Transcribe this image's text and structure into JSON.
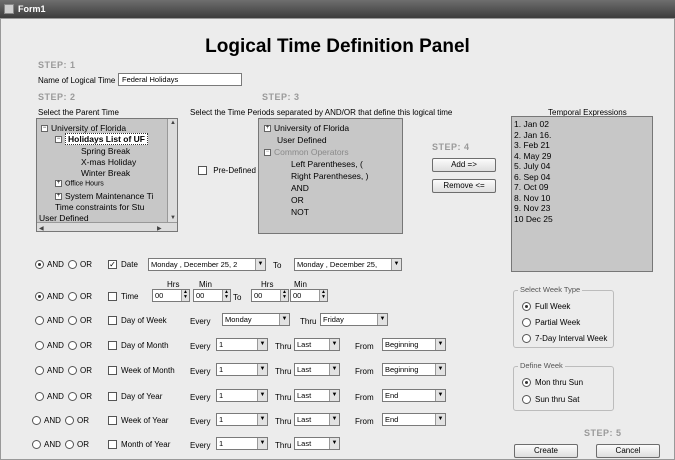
{
  "window": {
    "title": "Form1"
  },
  "page_title": "Logical Time Definition Panel",
  "steps": {
    "s1": "STEP: 1",
    "s2": "STEP: 2",
    "s3": "STEP: 3",
    "s4": "STEP: 4",
    "s5": "STEP: 5"
  },
  "name": {
    "label": "Name of Logical Time",
    "value": "Federal Holidays"
  },
  "parent": {
    "label": "Select the Parent Time",
    "items": {
      "uf": "University of Florida",
      "holidays": "Holidays List of UF",
      "spring": "Spring Break",
      "xmas": "X-mas Holiday",
      "winter": "Winter Break",
      "office": "Office Hours",
      "sysmaint": "System Maintenance Ti",
      "constraints": "Time constraints for Stu",
      "userdef": "User Defined"
    }
  },
  "periods": {
    "label": "Select the  Time Periods separated by AND/OR that define this logical time",
    "predefined_label": "Pre-Defined",
    "items": {
      "uf": "University of Florida",
      "userdef": "User Defined",
      "common": "Common Operators",
      "lparen": "Left Parentheses, (",
      "rparen": "Right Parentheses, )",
      "and": "AND",
      "or": "OR",
      "not": "NOT"
    }
  },
  "buttons": {
    "add": "Add =>",
    "remove": "Remove <=",
    "create": "Create",
    "cancel": "Cancel"
  },
  "temporal": {
    "label": "Temporal Expressions",
    "items": [
      "1. Jan 02",
      "2. Jan 16.",
      "3. Feb 21",
      "4. May 29",
      "5. July 04",
      "6. Sep 04",
      "7. Oct 09",
      "8. Nov 10",
      "9. Nov 23",
      "10 Dec 25"
    ]
  },
  "ops": {
    "and": "AND",
    "or": "OR"
  },
  "words": {
    "to": "To",
    "every": "Every",
    "thru": "Thru",
    "from": "From",
    "hrs": "Hrs",
    "min": "Min"
  },
  "rows": {
    "date": {
      "label": "Date",
      "from": "Monday    , December 25, 2",
      "to": "Monday    , December 25,"
    },
    "time": {
      "label": "Time",
      "h1": "00",
      "m1": "00",
      "h2": "00",
      "m2": "00"
    },
    "dow": {
      "label": "Day of Week",
      "every": "Monday",
      "thru": "Friday"
    },
    "dom": {
      "label": "Day of Month",
      "every": "1",
      "thru": "Last",
      "from": "Beginning"
    },
    "wom": {
      "label": "Week of Month",
      "every": "1",
      "thru": "Last",
      "from": "Beginning"
    },
    "doy": {
      "label": "Day of Year",
      "every": "1",
      "thru": "Last",
      "from": "End"
    },
    "woy": {
      "label": "Week of Year",
      "every": "1",
      "thru": "Last",
      "from": "End"
    },
    "moy": {
      "label": "Month of Year",
      "every": "1",
      "thru": "Last"
    }
  },
  "week_type": {
    "title": "Select Week Type",
    "full": "Full Week",
    "partial": "Partial Week",
    "interval": "7-Day Interval Week"
  },
  "define_week": {
    "title": "Define Week",
    "mon": "Mon thru Sun",
    "sun": "Sun thru Sat"
  }
}
